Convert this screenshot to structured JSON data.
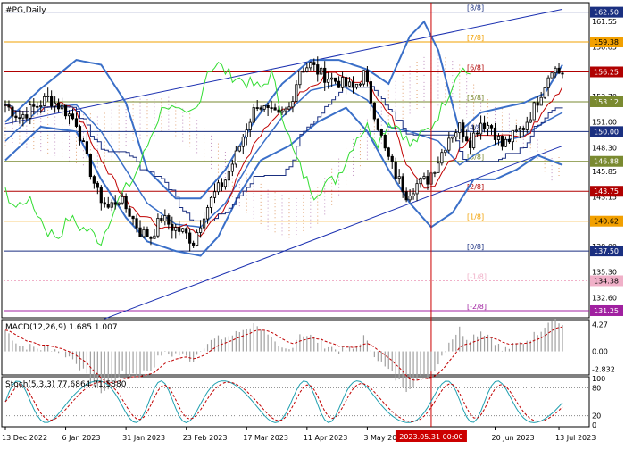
{
  "header": {
    "symbol_label": "#PG,Daily"
  },
  "colors": {
    "background": "#ffffff",
    "candle": "#000000",
    "bollinger": "#3a6fc8",
    "tenkan": "#c00000",
    "kijun": "#1a2f80",
    "chikou": "#33dd33",
    "cloud": "#e0a070",
    "cloud_alt": "#c090c0",
    "vertical_marker": "#cc0000",
    "price_badge": "#1a2f80",
    "level_red": "#b00000",
    "level_orange": "#f2a000",
    "level_olive": "#7a8a30",
    "level_navy": "#1a2f80",
    "level_pink": "#f0b0c8",
    "level_purple": "#a020a0",
    "macd_hist": "#a0a0a0",
    "macd_signal": "#c00000",
    "stoch_main": "#20a0b0",
    "stoch_signal": "#c00000"
  },
  "chart_data": {
    "type": "candlestick",
    "symbol": "#PG",
    "timeframe": "Daily",
    "ylim": [
      130.5,
      163.4
    ],
    "x_ticks": [
      "13 Dec 2022",
      "6 Jan 2023",
      "31 Jan 2023",
      "23 Feb 2023",
      "17 Mar 2023",
      "11 Apr 2023",
      "3 May 2023",
      "2023.05.31 00:00",
      "20 Jun 2023",
      "13 Jul 2023"
    ],
    "x_tick_index": [
      0,
      17,
      34,
      51,
      68,
      85,
      102,
      120,
      138,
      156
    ],
    "vertical_marker_label": "2023.05.31 00:00",
    "vertical_marker_index": 120,
    "y_axis_ticks": [
      161.55,
      158.85,
      156.15,
      153.7,
      151.0,
      148.3,
      145.85,
      143.15,
      140.45,
      138.0,
      135.3,
      132.6
    ],
    "murrey_levels": [
      {
        "price": 162.5,
        "label": "[8/8]",
        "color": "#1a2f80"
      },
      {
        "price": 159.38,
        "label": "[7/8]",
        "color": "#f2a000"
      },
      {
        "price": 156.25,
        "label": "[6/8]",
        "color": "#b00000"
      },
      {
        "price": 153.12,
        "label": "[5/8]",
        "color": "#7a8a30"
      },
      {
        "price": 150.0,
        "label": "[4/8]",
        "color": "#1a2f80"
      },
      {
        "price": 146.88,
        "label": "[3/8]",
        "color": "#7a8a30"
      },
      {
        "price": 143.75,
        "label": "[2/8]",
        "color": "#b00000"
      },
      {
        "price": 140.62,
        "label": "[1/8]",
        "color": "#f2a000"
      },
      {
        "price": 137.5,
        "label": "[0/8]",
        "color": "#1a2f80"
      },
      {
        "price": 134.38,
        "label": "[-1/8]",
        "color": "#f0b0c8"
      },
      {
        "price": 131.25,
        "label": "[-2/8]",
        "color": "#a020a0"
      }
    ],
    "close_anchors": [
      [
        0,
        152.8
      ],
      [
        4,
        151.5
      ],
      [
        8,
        152.5
      ],
      [
        12,
        153.5
      ],
      [
        16,
        152.5
      ],
      [
        20,
        151.0
      ],
      [
        23,
        147.0
      ],
      [
        26,
        143.5
      ],
      [
        29,
        142.0
      ],
      [
        32,
        143.0
      ],
      [
        35,
        141.5
      ],
      [
        38,
        139.5
      ],
      [
        41,
        139.0
      ],
      [
        44,
        141.0
      ],
      [
        47,
        140.0
      ],
      [
        50,
        139.5
      ],
      [
        53,
        138.5
      ],
      [
        56,
        141.5
      ],
      [
        59,
        143.5
      ],
      [
        62,
        145.0
      ],
      [
        65,
        147.5
      ],
      [
        68,
        150.5
      ],
      [
        71,
        153.0
      ],
      [
        74,
        152.0
      ],
      [
        77,
        151.5
      ],
      [
        80,
        152.5
      ],
      [
        83,
        156.5
      ],
      [
        86,
        157.0
      ],
      [
        89,
        156.0
      ],
      [
        92,
        155.5
      ],
      [
        95,
        155.0
      ],
      [
        98,
        154.5
      ],
      [
        101,
        156.0
      ],
      [
        104,
        152.0
      ],
      [
        107,
        148.0
      ],
      [
        110,
        145.5
      ],
      [
        113,
        143.5
      ],
      [
        116,
        144.5
      ],
      [
        119,
        145.0
      ],
      [
        122,
        147.0
      ],
      [
        125,
        149.5
      ],
      [
        128,
        150.5
      ],
      [
        131,
        149.0
      ],
      [
        134,
        151.0
      ],
      [
        137,
        150.5
      ],
      [
        140,
        148.5
      ],
      [
        143,
        149.5
      ],
      [
        146,
        150.5
      ],
      [
        149,
        152.5
      ],
      [
        152,
        155.0
      ],
      [
        154,
        156.8
      ],
      [
        156,
        156.2
      ]
    ],
    "upper_band_anchors": [
      [
        0,
        151.0
      ],
      [
        10,
        154.5
      ],
      [
        20,
        157.5
      ],
      [
        27,
        157.0
      ],
      [
        34,
        153.0
      ],
      [
        40,
        146.0
      ],
      [
        48,
        143.0
      ],
      [
        55,
        143.0
      ],
      [
        62,
        146.0
      ],
      [
        70,
        151.0
      ],
      [
        78,
        155.0
      ],
      [
        86,
        157.5
      ],
      [
        94,
        157.5
      ],
      [
        102,
        156.5
      ],
      [
        108,
        155.0
      ],
      [
        114,
        160.0
      ],
      [
        118,
        161.5
      ],
      [
        122,
        158.5
      ],
      [
        128,
        150.0
      ],
      [
        134,
        152.0
      ],
      [
        140,
        152.5
      ],
      [
        146,
        153.0
      ],
      [
        152,
        154.0
      ],
      [
        157,
        157.0
      ]
    ],
    "lower_band_anchors": [
      [
        0,
        147.0
      ],
      [
        10,
        150.5
      ],
      [
        20,
        150.0
      ],
      [
        27,
        145.0
      ],
      [
        34,
        141.0
      ],
      [
        40,
        138.5
      ],
      [
        48,
        137.5
      ],
      [
        55,
        137.0
      ],
      [
        60,
        139.0
      ],
      [
        66,
        143.5
      ],
      [
        72,
        147.0
      ],
      [
        80,
        148.5
      ],
      [
        88,
        151.0
      ],
      [
        96,
        152.5
      ],
      [
        102,
        150.0
      ],
      [
        108,
        146.0
      ],
      [
        114,
        142.5
      ],
      [
        120,
        140.0
      ],
      [
        126,
        141.5
      ],
      [
        132,
        145.0
      ],
      [
        138,
        145.0
      ],
      [
        144,
        146.0
      ],
      [
        150,
        147.5
      ],
      [
        157,
        146.5
      ]
    ],
    "middle_band_anchors": [
      [
        0,
        149.0
      ],
      [
        10,
        152.5
      ],
      [
        20,
        152.8
      ],
      [
        27,
        150.0
      ],
      [
        34,
        146.0
      ],
      [
        40,
        142.5
      ],
      [
        48,
        140.3
      ],
      [
        55,
        140.0
      ],
      [
        62,
        142.5
      ],
      [
        70,
        147.5
      ],
      [
        78,
        151.5
      ],
      [
        86,
        154.3
      ],
      [
        94,
        155.0
      ],
      [
        102,
        153.3
      ],
      [
        108,
        150.5
      ],
      [
        114,
        150.0
      ],
      [
        118,
        149.5
      ],
      [
        122,
        149.0
      ],
      [
        128,
        146.5
      ],
      [
        134,
        148.0
      ],
      [
        140,
        149.0
      ],
      [
        146,
        149.5
      ],
      [
        152,
        151.0
      ],
      [
        157,
        152.0
      ]
    ],
    "macd": {
      "label": "MACD(12,26,9) 1.685 1.007",
      "ylim": [
        -3.5,
        4.8
      ],
      "ticks": [
        4.27,
        0.0,
        -2.832
      ]
    },
    "stochastic": {
      "label": "Stoch(5,3,3) 77.6864 71.5880",
      "ylim": [
        0,
        100
      ],
      "ticks": [
        100,
        80,
        20,
        0
      ]
    },
    "price_badges": [
      {
        "value": "162.50",
        "highlight": false
      },
      {
        "value": "159.38",
        "highlight": false
      },
      {
        "value": "156.25",
        "highlight": false
      },
      {
        "value": "153.12",
        "highlight": false
      },
      {
        "value": "150.00",
        "highlight": false
      },
      {
        "value": "146.88",
        "highlight": false
      },
      {
        "value": "143.75",
        "highlight": false
      },
      {
        "value": "140.62",
        "highlight": false
      },
      {
        "value": "137.50",
        "highlight": false
      },
      {
        "value": "134.38",
        "highlight": false
      },
      {
        "value": "131.25",
        "highlight": false
      }
    ]
  }
}
